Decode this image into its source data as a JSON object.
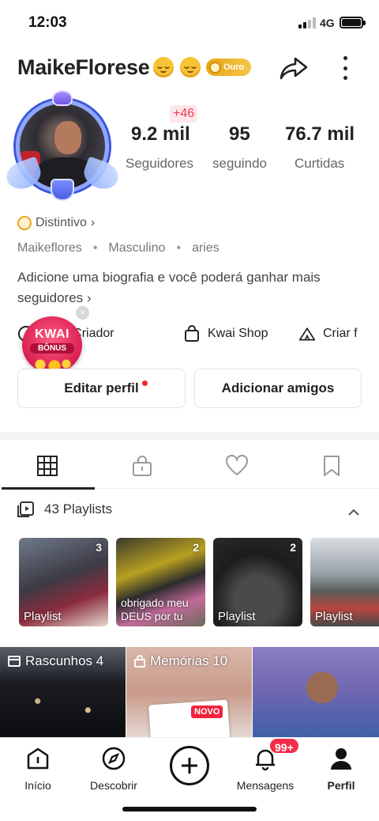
{
  "status": {
    "time": "12:03",
    "network": "4G"
  },
  "profile": {
    "name": "MaikeFlorese",
    "badge": "Ouro",
    "new_followers": "+46",
    "stats": [
      {
        "value": "9.2 mil",
        "label": "Seguidores"
      },
      {
        "value": "95",
        "label": "seguindo"
      },
      {
        "value": "76.7 mil",
        "label": "Curtidas"
      }
    ],
    "distintivo": "Distintivo",
    "info": [
      "Maikeflores",
      "Masculino",
      "aries"
    ],
    "bio": "Adicione uma biografia e você poderá ganhar mais seguidores"
  },
  "shortcuts": [
    "al do Criador",
    "Kwai Shop",
    "Criar f"
  ],
  "kwai_bonus": {
    "line1": "KWAI",
    "line2": "BÔNUS",
    "close": "×"
  },
  "buttons": {
    "edit": "Editar perfil",
    "add_friends": "Adicionar amigos"
  },
  "tabs": [
    "posts",
    "private",
    "liked",
    "saved"
  ],
  "playlists": {
    "header": "43 Playlists",
    "items": [
      {
        "count": "3",
        "caption": "Playlist"
      },
      {
        "count": "2",
        "caption": "obrigado meu DEUS por tu"
      },
      {
        "count": "2",
        "caption": "Playlist"
      },
      {
        "count": "",
        "caption": "Playlist"
      }
    ]
  },
  "grid": {
    "drafts": "Rascunhos 4",
    "memories": "Memórias 10",
    "new_tag": "NOVO"
  },
  "nav": {
    "items": [
      {
        "label": "Início"
      },
      {
        "label": "Descobrir"
      },
      {
        "label": ""
      },
      {
        "label": "Mensagens"
      },
      {
        "label": "Perfil"
      }
    ],
    "messages_badge": "99+"
  },
  "colors": {
    "accent_red": "#f42c4a",
    "gold": "#e8a613"
  }
}
